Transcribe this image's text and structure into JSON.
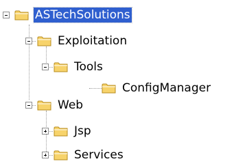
{
  "tree": {
    "nodes": [
      {
        "label": "ASTechSolutions",
        "state": "expanded",
        "selected": true
      },
      {
        "label": "Exploitation",
        "state": "expanded",
        "selected": false
      },
      {
        "label": "Tools",
        "state": "expanded",
        "selected": false
      },
      {
        "label": "ConfigManager",
        "state": "leaf",
        "selected": false
      },
      {
        "label": "Web",
        "state": "expanded",
        "selected": false
      },
      {
        "label": "Jsp",
        "state": "collapsed",
        "selected": false
      },
      {
        "label": "Services",
        "state": "collapsed",
        "selected": false
      }
    ]
  },
  "icons": {
    "folder": "folder-icon",
    "expanded_toggle": "minus-box-icon",
    "collapsed_toggle": "plus-box-icon"
  },
  "colors": {
    "selection": "#2f5fcf",
    "folder_fill": "#f7d36b",
    "folder_edge": "#b78b1e",
    "tree_line": "#9a9a9a"
  }
}
